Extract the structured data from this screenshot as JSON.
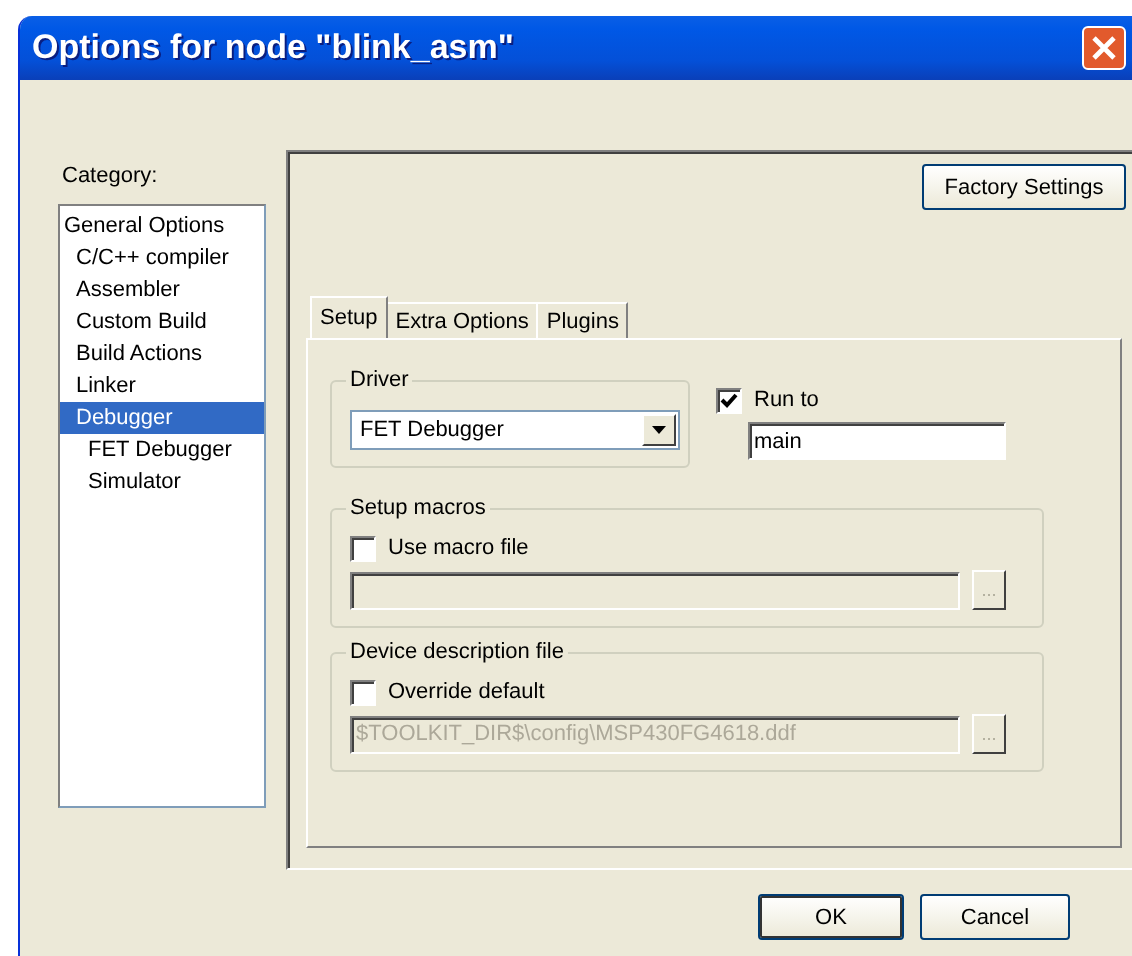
{
  "window": {
    "title": "Options for node \"blink_asm\""
  },
  "category": {
    "label": "Category:",
    "items": [
      {
        "label": "General Options",
        "selected": false,
        "children": [
          {
            "label": "C/C++ compiler",
            "selected": false
          },
          {
            "label": "Assembler",
            "selected": false
          },
          {
            "label": "Custom Build",
            "selected": false
          },
          {
            "label": "Build Actions",
            "selected": false
          },
          {
            "label": "Linker",
            "selected": false
          },
          {
            "label": "Debugger",
            "selected": true,
            "children": [
              {
                "label": "FET Debugger",
                "selected": false
              },
              {
                "label": "Simulator",
                "selected": false
              }
            ]
          }
        ]
      }
    ]
  },
  "factory_button": "Factory Settings",
  "tabs": [
    {
      "label": "Setup",
      "selected": true
    },
    {
      "label": "Extra Options",
      "selected": false
    },
    {
      "label": "Plugins",
      "selected": false
    }
  ],
  "driver": {
    "label": "Driver",
    "value": "FET Debugger"
  },
  "run_to": {
    "label": "Run to",
    "checked": true,
    "value": "main"
  },
  "setup_macros": {
    "label": "Setup macros",
    "checkbox": "Use macro file",
    "checked": false,
    "disabled": true,
    "browse": "..."
  },
  "device_file": {
    "label": "Device description file",
    "checkbox": "Override default",
    "checked": false,
    "disabled": true,
    "value": "$TOOLKIT_DIR$\\config\\MSP430FG4618.ddf",
    "browse": "..."
  },
  "buttons": [
    {
      "label": "OK",
      "default": true
    },
    {
      "label": "Cancel",
      "default": false
    }
  ]
}
